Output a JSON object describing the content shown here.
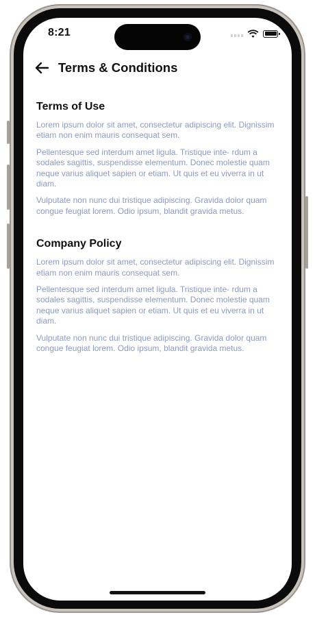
{
  "status_bar": {
    "time": "8:21",
    "icons": [
      "cellular-signal-icon",
      "wifi-icon",
      "battery-icon"
    ]
  },
  "header": {
    "back_icon": "arrow-left-icon",
    "title": "Terms & Conditions"
  },
  "sections": [
    {
      "title": "Terms of Use",
      "paragraphs": [
        "Lorem ipsum dolor sit amet, consectetur adipiscing elit. Dignissim etiam non enim mauris consequat sem.",
        "Pellentesque sed interdum amet ligula. Tristique inte- rdum a sodales sagittis, suspendisse elementum. Donec molestie quam neque varius aliquet sapien or etiam. Ut quis et eu viverra in ut diam.",
        "Vulputate non nunc dui tristique adipiscing. Gravida dolor quam congue feugiat lorem. Odio ipsum, blandit gravida metus."
      ]
    },
    {
      "title": "Company Policy",
      "paragraphs": [
        "Lorem ipsum dolor sit amet, consectetur adipiscing elit. Dignissim etiam non enim mauris consequat sem.",
        "Pellentesque sed interdum amet ligula. Tristique inte- rdum a sodales sagittis, suspendisse elementum. Donec molestie quam neque varius aliquet sapien or etiam. Ut quis et eu viverra in ut diam.",
        "Vulputate non nunc dui tristique adipiscing. Gravida dolor quam congue feugiat lorem. Odio ipsum, blandit gravida metus."
      ]
    }
  ],
  "colors": {
    "title_text": "#111111",
    "body_text": "#8b9ac4",
    "background": "#ffffff"
  }
}
